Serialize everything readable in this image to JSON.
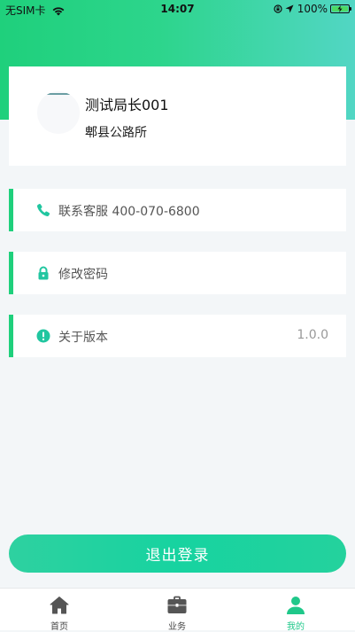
{
  "status_bar": {
    "carrier": "无SIM卡",
    "time": "14:07",
    "battery_pct": "100%",
    "battery_level": 1.0
  },
  "profile": {
    "name": "测试局长001",
    "org": "郫县公路所"
  },
  "menu": {
    "items": [
      {
        "icon": "phone-icon",
        "label": "联系客服 400-070-6800",
        "value": ""
      },
      {
        "icon": "lock-icon",
        "label": "修改密码",
        "value": ""
      },
      {
        "icon": "info-icon",
        "label": "关于版本",
        "value": "1.0.0"
      }
    ]
  },
  "logout": {
    "label": "退出登录"
  },
  "tabs": [
    {
      "icon": "home-icon",
      "label": "首页",
      "active": false
    },
    {
      "icon": "briefcase-icon",
      "label": "业务",
      "active": false
    },
    {
      "icon": "user-icon",
      "label": "我的",
      "active": true
    }
  ],
  "colors": {
    "accent": "#1fd07c",
    "header_gradient_start": "#1fd07c",
    "header_gradient_end": "#52d6c4",
    "logout_button": "#17d3a0",
    "active_tab": "#1fc88a",
    "icon_teal": "#21c6a0"
  }
}
